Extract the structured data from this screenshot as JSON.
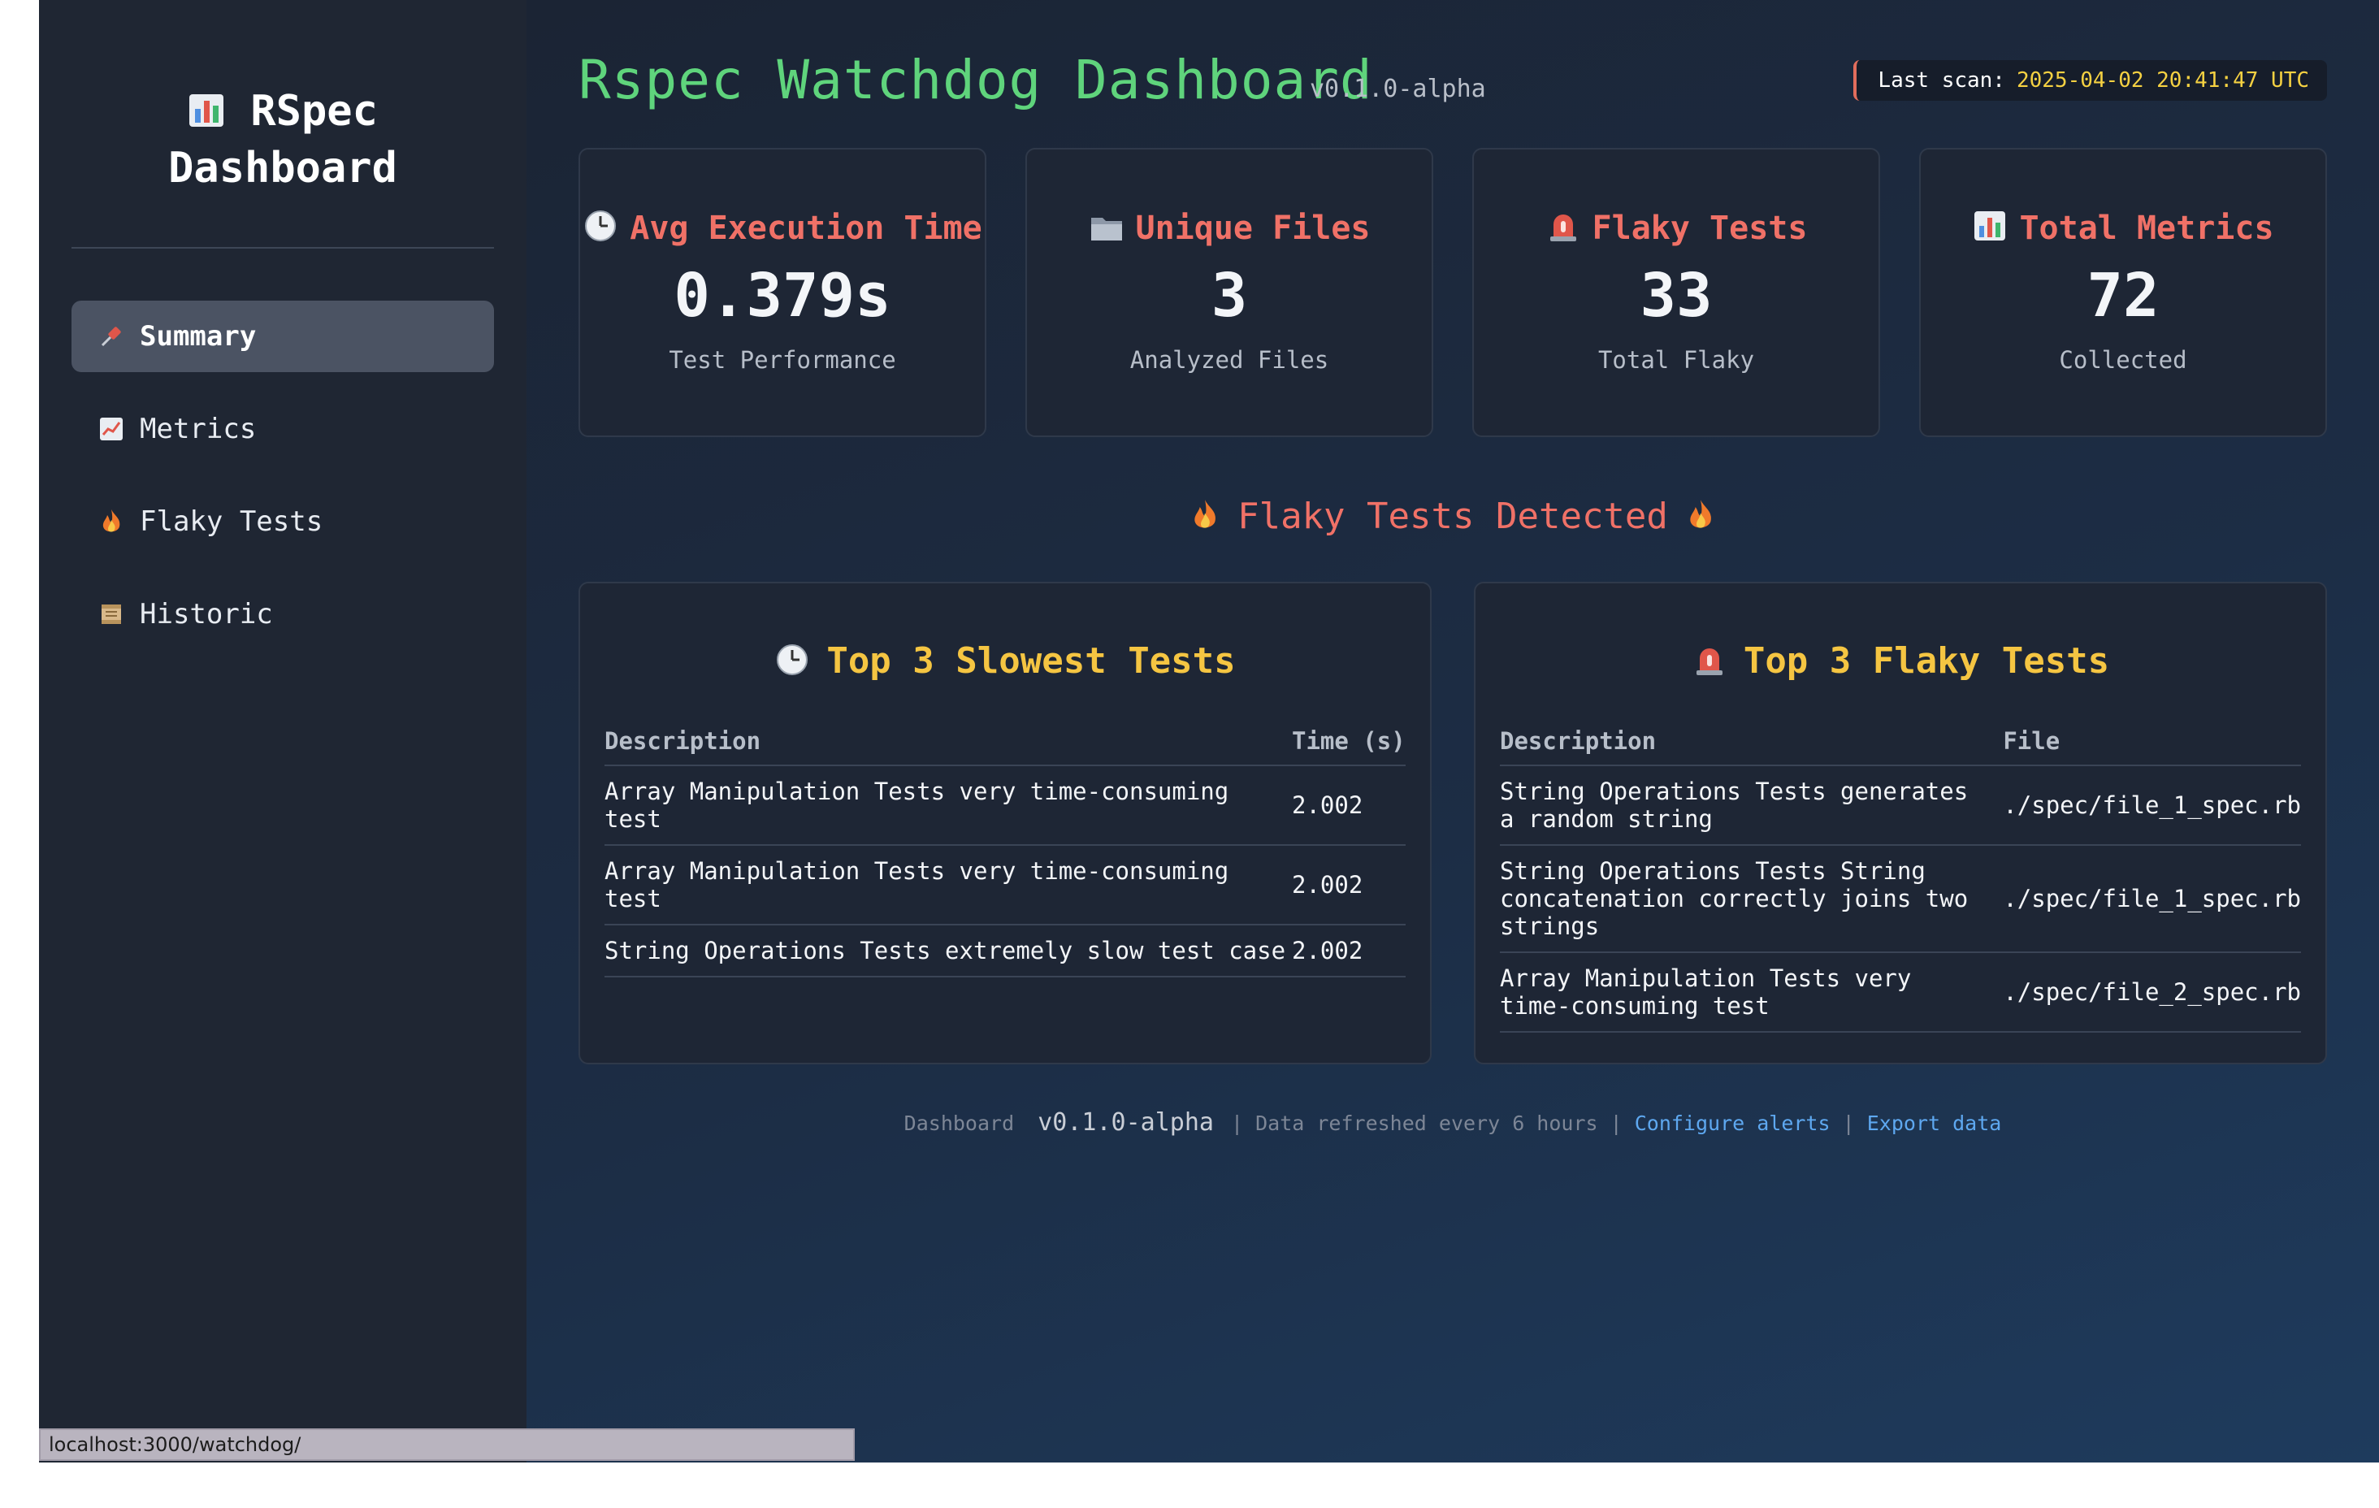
{
  "sidebar": {
    "brand_line1": "RSpec",
    "brand_line2": "Dashboard",
    "brand_icon": "bar-chart-icon",
    "items": [
      {
        "label": "Summary",
        "icon": "pushpin-icon",
        "active": true
      },
      {
        "label": "Metrics",
        "icon": "line-chart-icon",
        "active": false
      },
      {
        "label": "Flaky Tests",
        "icon": "fire-icon",
        "active": false
      },
      {
        "label": "Historic",
        "icon": "scroll-icon",
        "active": false
      }
    ]
  },
  "header": {
    "title": "Rspec Watchdog Dashboard",
    "version": "v0.1.0-alpha",
    "scan_label": "Last scan:",
    "scan_time": "2025-04-02 20:41:47 UTC"
  },
  "cards": [
    {
      "icon": "clock-icon",
      "title": "Avg Execution Time",
      "value": "0.379s",
      "sub": "Test Performance"
    },
    {
      "icon": "folder-icon",
      "title": "Unique Files",
      "value": "3",
      "sub": "Analyzed Files"
    },
    {
      "icon": "siren-icon",
      "title": "Flaky Tests",
      "value": "33",
      "sub": "Total Flaky"
    },
    {
      "icon": "bar-chart-icon",
      "title": "Total Metrics",
      "value": "72",
      "sub": "Collected"
    }
  ],
  "flaky_heading": "Flaky Tests Detected",
  "slowest": {
    "title": "Top 3 Slowest Tests",
    "headers": [
      "Description",
      "Time (s)"
    ],
    "rows": [
      [
        "Array Manipulation Tests very time-consuming test",
        "2.002"
      ],
      [
        "Array Manipulation Tests very time-consuming test",
        "2.002"
      ],
      [
        "String Operations Tests extremely slow test case",
        "2.002"
      ]
    ]
  },
  "flaky": {
    "title": "Top 3 Flaky Tests",
    "headers": [
      "Description",
      "File"
    ],
    "rows": [
      [
        "String Operations Tests generates a random string",
        "./spec/file_1_spec.rb"
      ],
      [
        "String Operations Tests String concatenation correctly joins two strings",
        "./spec/file_1_spec.rb"
      ],
      [
        "Array Manipulation Tests very time-consuming test",
        "./spec/file_2_spec.rb"
      ]
    ]
  },
  "footer": {
    "label": "Dashboard",
    "version": "v0.1.0-alpha",
    "refresh": "| Data refreshed every 6 hours |",
    "configure": "Configure alerts",
    "sep": "|",
    "export": "Export data"
  },
  "statusbar": {
    "url": "localhost:3000/watchdog/"
  },
  "colors": {
    "title_green": "#5fd47c",
    "card_title_red": "#f07167",
    "panel_title_yellow": "#f5c542",
    "scan_time_yellow": "#f5d142",
    "link_blue": "#5ea8f0"
  }
}
